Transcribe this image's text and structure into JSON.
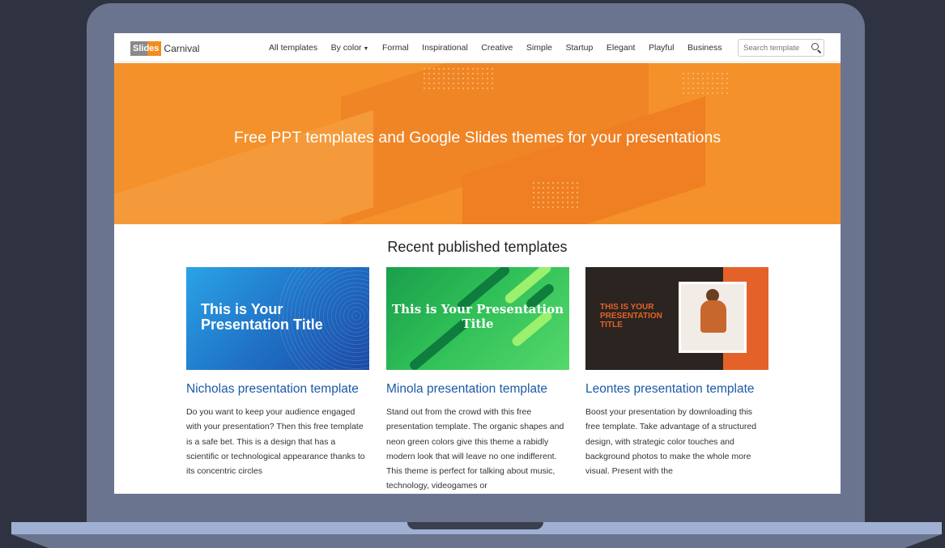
{
  "logo": {
    "part1": "Slides",
    "part2": "Carnival"
  },
  "nav": {
    "links": [
      "All templates",
      "By color",
      "Formal",
      "Inspirational",
      "Creative",
      "Simple",
      "Startup",
      "Elegant",
      "Playful",
      "Business"
    ],
    "search_placeholder": "Search template"
  },
  "hero": {
    "title": "Free PPT templates and Google Slides themes for your presentations"
  },
  "recent": {
    "heading": "Recent published templates",
    "cards": [
      {
        "thumb_title": "This is Your Presentation Title",
        "title": "Nicholas presentation template",
        "desc": "Do you want to keep your audience engaged with your presentation? Then this free template is a safe bet. This is a design that has a scientific or technological appearance thanks to its concentric circles"
      },
      {
        "thumb_title": "This is Your Presentation Title",
        "title": "Minola presentation template",
        "desc": "Stand out from the crowd with this free presentation template. The organic shapes and neon green colors give this theme a rabidly modern look that will leave no one indifferent. This theme is perfect for talking about music, technology, videogames or"
      },
      {
        "thumb_title": "THIS IS YOUR PRESENTATION TITLE",
        "title": "Leontes presentation template",
        "desc": "Boost your presentation by downloading this free template. Take advantage of a structured design, with strategic color touches and background photos to make the whole more visual. Present with the"
      }
    ]
  },
  "colors": {
    "brand_orange": "#f4912b",
    "link_blue": "#1d5aa6",
    "laptop_body": "#6b748f"
  },
  "icons": {
    "search": "search-icon",
    "caret": "caret-down-icon"
  }
}
